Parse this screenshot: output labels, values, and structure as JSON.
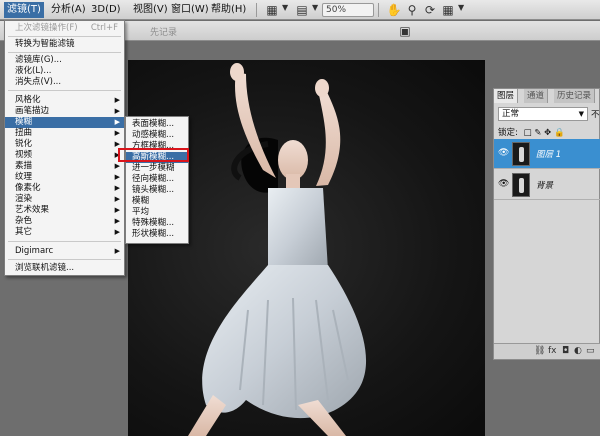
{
  "menubar": {
    "items": [
      "滤镜(T)",
      "分析(A)",
      "3D(D)",
      "视图(V)",
      "窗口(W)",
      "帮助(H)"
    ],
    "zoom": "50%"
  },
  "options_bar": {
    "hint": "先记录"
  },
  "filter_menu": {
    "items": [
      {
        "label": "上次滤镜操作(F)",
        "shortcut": "Ctrl+F",
        "disabled": true
      },
      {
        "label": "转换为智能滤镜"
      },
      {
        "label": "滤镜库(G)..."
      },
      {
        "label": "液化(L)..."
      },
      {
        "label": "消失点(V)..."
      },
      {
        "label": "风格化",
        "sub": true
      },
      {
        "label": "画笔描边",
        "sub": true
      },
      {
        "label": "模糊",
        "sub": true,
        "highlighted": true
      },
      {
        "label": "扭曲",
        "sub": true
      },
      {
        "label": "锐化",
        "sub": true
      },
      {
        "label": "视频",
        "sub": true
      },
      {
        "label": "素描",
        "sub": true
      },
      {
        "label": "纹理",
        "sub": true
      },
      {
        "label": "像素化",
        "sub": true
      },
      {
        "label": "渲染",
        "sub": true
      },
      {
        "label": "艺术效果",
        "sub": true
      },
      {
        "label": "杂色",
        "sub": true
      },
      {
        "label": "其它",
        "sub": true
      },
      {
        "label": "Digimarc",
        "sub": true
      },
      {
        "label": "浏览联机滤镜..."
      }
    ]
  },
  "blur_submenu": {
    "items": [
      "表面模糊...",
      "动感模糊...",
      "方框模糊...",
      "高斯模糊...",
      "进一步模糊",
      "径向模糊...",
      "镜头模糊...",
      "模糊",
      "平均",
      "特殊模糊...",
      "形状模糊..."
    ],
    "highlighted": "高斯模糊..."
  },
  "layers_panel": {
    "tabs": [
      "图层",
      "通道",
      "历史记录"
    ],
    "blend_mode": "正常",
    "opacity_label": "不",
    "lock_label": "锁定:",
    "layers": [
      {
        "name": "图层 1",
        "selected": true
      },
      {
        "name": "背景",
        "selected": false
      }
    ]
  },
  "colors": {
    "accent": "#3a6ea5",
    "highlight_box": "#d9141b",
    "selected_layer": "#3a8fd0"
  }
}
